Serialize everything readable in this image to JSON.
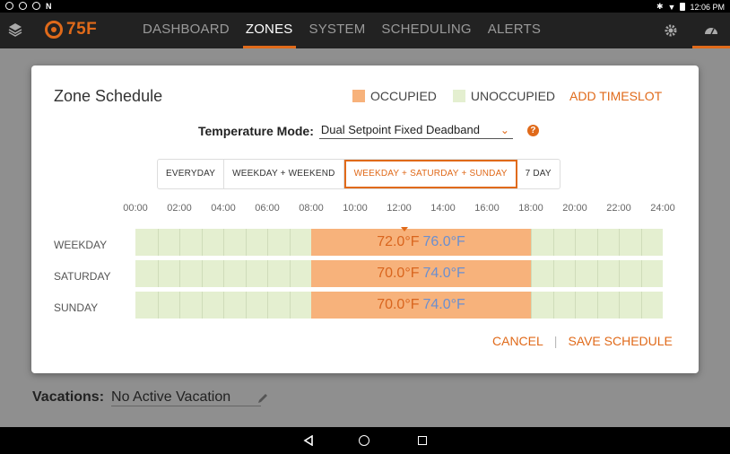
{
  "status_bar": {
    "time": "12:06 PM"
  },
  "app": {
    "logo_text": "75F"
  },
  "nav": {
    "items": [
      {
        "label": "DASHBOARD",
        "active": false
      },
      {
        "label": "ZONES",
        "active": true
      },
      {
        "label": "SYSTEM",
        "active": false
      },
      {
        "label": "SCHEDULING",
        "active": false
      },
      {
        "label": "ALERTS",
        "active": false
      }
    ]
  },
  "background": {
    "vacations_label": "Vacations:",
    "vacations_value": "No Active Vacation"
  },
  "modal": {
    "title": "Zone Schedule",
    "legend": {
      "occupied": "OCCUPIED",
      "unoccupied": "UNOCCUPIED"
    },
    "add_timeslot": "ADD TIMESLOT",
    "temperature_mode_label": "Temperature Mode:",
    "temperature_mode_value": "Dual Setpoint Fixed Deadband",
    "schedule_types": [
      {
        "label": "EVERYDAY",
        "active": false
      },
      {
        "label": "WEEKDAY + WEEKEND",
        "active": false
      },
      {
        "label": "WEEKDAY + SATURDAY + SUNDAY",
        "active": true
      },
      {
        "label": "7 DAY",
        "active": false
      }
    ],
    "time_labels": [
      "00:00",
      "02:00",
      "04:00",
      "06:00",
      "08:00",
      "10:00",
      "12:00",
      "14:00",
      "16:00",
      "18:00",
      "20:00",
      "22:00",
      "24:00"
    ],
    "rows": [
      {
        "day": "WEEKDAY",
        "start_hour": 8.0,
        "end_hour": 18.0,
        "heat": "72.0°F",
        "cool": "76.0°F"
      },
      {
        "day": "SATURDAY",
        "start_hour": 8.0,
        "end_hour": 18.0,
        "heat": "70.0°F",
        "cool": "74.0°F"
      },
      {
        "day": "SUNDAY",
        "start_hour": 8.0,
        "end_hour": 18.0,
        "heat": "70.0°F",
        "cool": "74.0°F"
      }
    ],
    "cancel_label": "CANCEL",
    "save_label": "SAVE SCHEDULE"
  },
  "colors": {
    "accent": "#e06a1a",
    "occupied": "#f7b27b",
    "unoccupied": "#e4efd0",
    "cool_setpoint": "#6b8fd0"
  }
}
